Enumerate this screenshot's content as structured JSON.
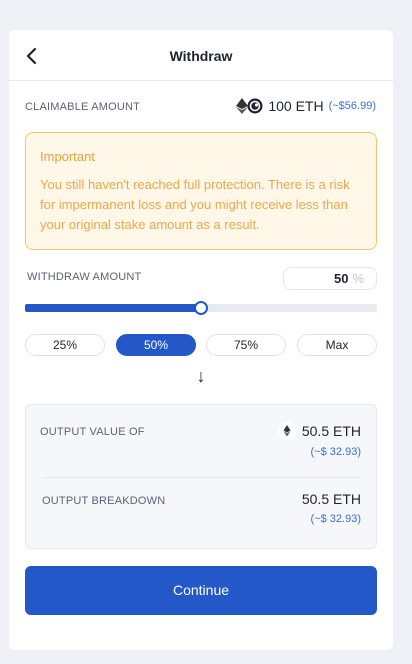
{
  "header": {
    "title": "Withdraw",
    "back_icon": "chevron-left-icon"
  },
  "claimable": {
    "label": "CLAIMABLE AMOUNT",
    "amount": "100 ETH",
    "usd": "(~$56.99)",
    "icons": [
      "eth-icon",
      "bancor-icon"
    ]
  },
  "warning": {
    "title": "Important",
    "body": "You still haven't reached full protection. There is a risk for impermanent loss and you might receive less than your original stake amount as a result."
  },
  "withdraw": {
    "label": "WITHDRAW AMOUNT",
    "value": "50",
    "unit": "%",
    "slider_percent": 50
  },
  "presets": [
    {
      "label": "25%",
      "active": false
    },
    {
      "label": "50%",
      "active": true
    },
    {
      "label": "75%",
      "active": false
    },
    {
      "label": "Max",
      "active": false
    }
  ],
  "arrow": "↓",
  "output": {
    "value_label": "OUTPUT VALUE OF",
    "value_amount": "50.5 ETH",
    "value_usd": "(~$ 32.93)",
    "breakdown_label": "OUTPUT BREAKDOWN",
    "breakdown_amount": "50.5 ETH",
    "breakdown_usd": "(~$ 32.93)"
  },
  "continue_label": "Continue",
  "colors": {
    "accent": "#2458c8",
    "warning_text": "#e8a23b",
    "warning_bg": "#fff7e8",
    "warning_border": "#f6c56a",
    "usd_text": "#3b6fd4"
  }
}
